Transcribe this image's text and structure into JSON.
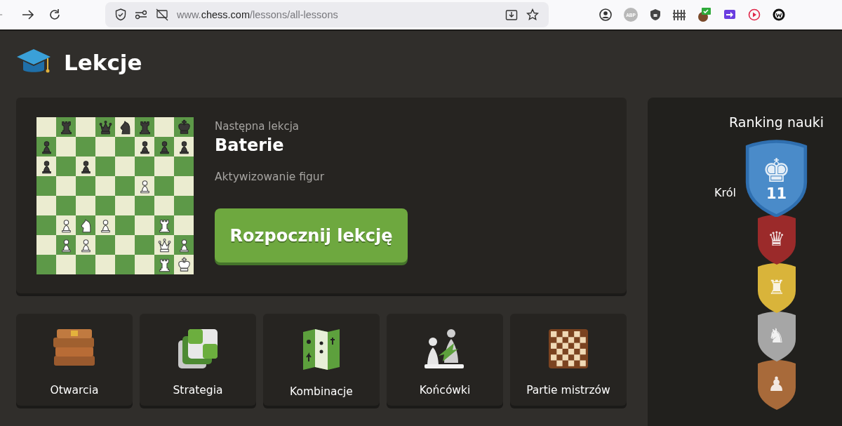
{
  "browser": {
    "url": {
      "prefix": "www.",
      "host": "chess.com",
      "path": "/lessons/all-lessons"
    },
    "extensions": [
      {
        "kind": "account"
      },
      {
        "kind": "abp",
        "label": "ABP"
      },
      {
        "kind": "lock"
      },
      {
        "kind": "fence"
      },
      {
        "kind": "cookie"
      },
      {
        "kind": "arrow"
      },
      {
        "kind": "play"
      },
      {
        "kind": "w"
      }
    ]
  },
  "header": {
    "title": "Lekcje"
  },
  "next_lesson": {
    "caption": "Następna lekcja",
    "title": "Baterie",
    "subtitle": "Aktywizowanie figur",
    "button": "Rozpocznij lekcję",
    "board": [
      [
        {
          "kind": "empty"
        },
        {
          "kind": "rook",
          "white": false
        },
        {
          "kind": "empty"
        },
        {
          "kind": "queen",
          "white": false
        },
        {
          "kind": "knight",
          "white": false
        },
        {
          "kind": "rook",
          "white": false
        },
        {
          "kind": "empty"
        },
        {
          "kind": "king",
          "white": false
        }
      ],
      [
        {
          "kind": "pawn",
          "white": false
        },
        {
          "kind": "empty"
        },
        {
          "kind": "empty"
        },
        {
          "kind": "empty"
        },
        {
          "kind": "empty"
        },
        {
          "kind": "pawn",
          "white": false
        },
        {
          "kind": "pawn",
          "white": false
        },
        {
          "kind": "pawn",
          "white": false
        }
      ],
      [
        {
          "kind": "pawn",
          "white": false
        },
        {
          "kind": "empty"
        },
        {
          "kind": "pawn",
          "white": false
        },
        {
          "kind": "empty"
        },
        {
          "kind": "empty"
        },
        {
          "kind": "empty"
        },
        {
          "kind": "empty"
        },
        {
          "kind": "empty"
        }
      ],
      [
        {
          "kind": "empty"
        },
        {
          "kind": "empty"
        },
        {
          "kind": "empty"
        },
        {
          "kind": "empty"
        },
        {
          "kind": "empty"
        },
        {
          "kind": "pawn",
          "white": true
        },
        {
          "kind": "empty"
        },
        {
          "kind": "empty"
        }
      ],
      [
        {
          "kind": "empty"
        },
        {
          "kind": "empty"
        },
        {
          "kind": "empty"
        },
        {
          "kind": "empty"
        },
        {
          "kind": "empty"
        },
        {
          "kind": "empty"
        },
        {
          "kind": "empty"
        },
        {
          "kind": "empty"
        }
      ],
      [
        {
          "kind": "empty"
        },
        {
          "kind": "pawn",
          "white": true
        },
        {
          "kind": "knight",
          "white": true
        },
        {
          "kind": "pawn",
          "white": true
        },
        {
          "kind": "empty"
        },
        {
          "kind": "empty"
        },
        {
          "kind": "rook",
          "white": true
        },
        {
          "kind": "empty"
        }
      ],
      [
        {
          "kind": "empty"
        },
        {
          "kind": "pawn",
          "white": true
        },
        {
          "kind": "pawn",
          "white": true
        },
        {
          "kind": "empty"
        },
        {
          "kind": "empty"
        },
        {
          "kind": "empty"
        },
        {
          "kind": "queen",
          "white": true
        },
        {
          "kind": "pawn",
          "white": true
        }
      ],
      [
        {
          "kind": "empty"
        },
        {
          "kind": "empty"
        },
        {
          "kind": "empty"
        },
        {
          "kind": "empty"
        },
        {
          "kind": "empty"
        },
        {
          "kind": "empty"
        },
        {
          "kind": "rook",
          "white": true
        },
        {
          "kind": "king",
          "white": true
        }
      ]
    ]
  },
  "categories": [
    {
      "kind": "books",
      "label": "Otwarcia"
    },
    {
      "kind": "cards",
      "label": "Strategia"
    },
    {
      "kind": "map",
      "label": "Kombinacje"
    },
    {
      "kind": "pawns",
      "label": "Końcówki"
    },
    {
      "kind": "checkerboard",
      "label": "Partie mistrzów"
    }
  ],
  "ranking": {
    "title": "Ranking nauki",
    "ranks": [
      {
        "label": "Król",
        "piece": "♚",
        "number": "11",
        "color": "#4a8bc9",
        "current": true
      },
      {
        "piece": "♛",
        "color": "#9b2a2a",
        "current": false
      },
      {
        "piece": "♜",
        "color": "#d9b43a",
        "current": false
      },
      {
        "piece": "♞",
        "color": "#a6a6a6",
        "current": false
      },
      {
        "piece": "♟",
        "color": "#a86a3a",
        "current": false
      }
    ]
  }
}
